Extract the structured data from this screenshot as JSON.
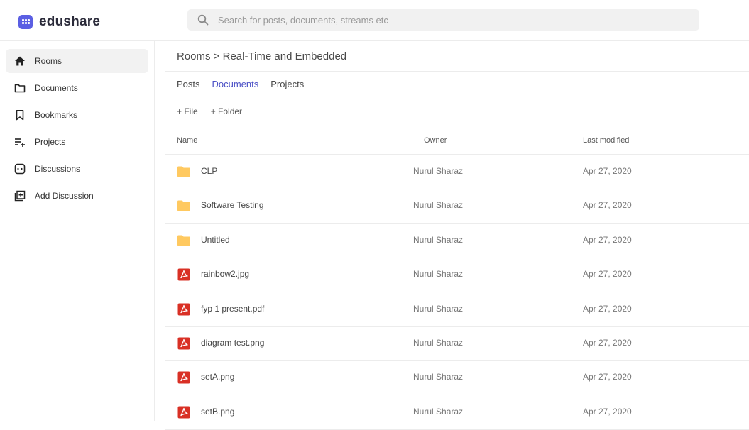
{
  "app": {
    "name": "edushare"
  },
  "search": {
    "placeholder": "Search for posts, documents, streams etc"
  },
  "sidebar": {
    "items": [
      {
        "label": "Rooms",
        "icon": "home-icon",
        "active": true
      },
      {
        "label": "Documents",
        "icon": "folder-icon",
        "active": false
      },
      {
        "label": "Bookmarks",
        "icon": "bookmark-icon",
        "active": false
      },
      {
        "label": "Projects",
        "icon": "playlist-add-icon",
        "active": false
      },
      {
        "label": "Discussions",
        "icon": "chat-icon",
        "active": false
      },
      {
        "label": "Add Discussion",
        "icon": "add-box-icon",
        "active": false
      }
    ]
  },
  "breadcrumb": "Rooms > Real-Time and Embedded",
  "tabs": [
    {
      "label": "Posts",
      "active": false
    },
    {
      "label": "Documents",
      "active": true
    },
    {
      "label": "Projects",
      "active": false
    }
  ],
  "actions": {
    "add_file": "+ File",
    "add_folder": "+ Folder"
  },
  "table": {
    "columns": {
      "name": "Name",
      "owner": "Owner",
      "modified": "Last modified"
    },
    "rows": [
      {
        "type": "folder",
        "name": "CLP",
        "owner": "Nurul Sharaz",
        "modified": "Apr 27, 2020"
      },
      {
        "type": "folder",
        "name": "Software Testing",
        "owner": "Nurul Sharaz",
        "modified": "Apr 27, 2020"
      },
      {
        "type": "folder",
        "name": "Untitled",
        "owner": "Nurul Sharaz",
        "modified": "Apr 27, 2020"
      },
      {
        "type": "file",
        "name": "rainbow2.jpg",
        "owner": "Nurul Sharaz",
        "modified": "Apr 27, 2020"
      },
      {
        "type": "file",
        "name": "fyp 1 present.pdf",
        "owner": "Nurul Sharaz",
        "modified": "Apr 27, 2020"
      },
      {
        "type": "file",
        "name": "diagram test.png",
        "owner": "Nurul Sharaz",
        "modified": "Apr 27, 2020"
      },
      {
        "type": "file",
        "name": "setA.png",
        "owner": "Nurul Sharaz",
        "modified": "Apr 27, 2020"
      },
      {
        "type": "file",
        "name": "setB.png",
        "owner": "Nurul Sharaz",
        "modified": "Apr 27, 2020"
      }
    ]
  },
  "colors": {
    "brand": "#5b5fe3",
    "active_tab": "#4a4fc5",
    "folder": "#ffc960",
    "file": "#d93025"
  }
}
